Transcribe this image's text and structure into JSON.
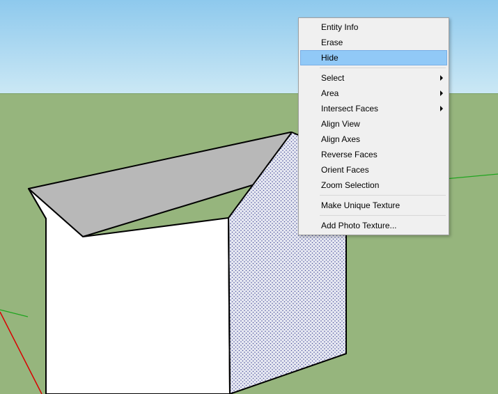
{
  "context_menu": {
    "items": [
      {
        "label": "Entity Info",
        "submenu": false,
        "highlighted": false
      },
      {
        "label": "Erase",
        "submenu": false,
        "highlighted": false
      },
      {
        "label": "Hide",
        "submenu": false,
        "highlighted": true
      }
    ],
    "items2": [
      {
        "label": "Select",
        "submenu": true,
        "highlighted": false
      },
      {
        "label": "Area",
        "submenu": true,
        "highlighted": false
      },
      {
        "label": "Intersect Faces",
        "submenu": true,
        "highlighted": false
      },
      {
        "label": "Align View",
        "submenu": false,
        "highlighted": false
      },
      {
        "label": "Align Axes",
        "submenu": false,
        "highlighted": false
      },
      {
        "label": "Reverse Faces",
        "submenu": false,
        "highlighted": false
      },
      {
        "label": "Orient Faces",
        "submenu": false,
        "highlighted": false
      },
      {
        "label": "Zoom Selection",
        "submenu": false,
        "highlighted": false
      }
    ],
    "items3": [
      {
        "label": "Make Unique Texture",
        "submenu": false,
        "highlighted": false
      }
    ],
    "items4": [
      {
        "label": "Add Photo Texture...",
        "submenu": false,
        "highlighted": false
      }
    ]
  },
  "colors": {
    "sky_top": "#8ec9ed",
    "sky_bottom": "#cbe8f5",
    "ground": "#96b57d",
    "wall_front": "#ffffff",
    "wall_side_selected": "#bbbfd9",
    "roof": "#b8b8b8",
    "edge": "#000000",
    "axis_green": "#1ea51e",
    "axis_red": "#d90000",
    "menu_highlight": "#91c9f7"
  }
}
